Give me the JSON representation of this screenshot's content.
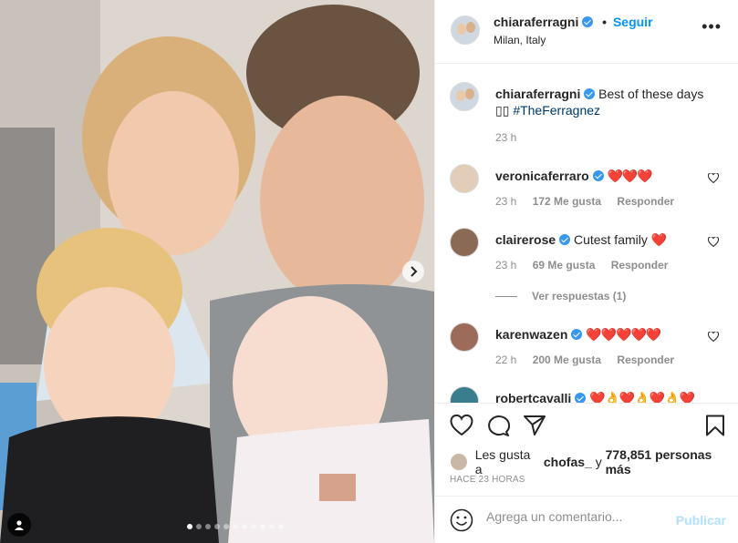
{
  "post": {
    "author": "chiaraferragni",
    "follow_separator": "•",
    "follow_label": "Seguir",
    "location": "Milan, Italy",
    "more_label": "•••",
    "carousel": {
      "slide_count": 11,
      "active_index": 0
    }
  },
  "caption": {
    "username": "chiaraferragni",
    "text": "Best of these days",
    "emoji_line": "▯▯",
    "hashtag": "#TheFerragnez",
    "time": "23 h"
  },
  "comments": [
    {
      "username": "veronicaferraro",
      "text": "",
      "hearts": "❤️❤️❤️",
      "time": "23 h",
      "likes": "172 Me gusta",
      "reply": "Responder"
    },
    {
      "username": "clairerose",
      "text": "Cutest family",
      "hearts": "❤️",
      "time": "23 h",
      "likes": "69 Me gusta",
      "reply": "Responder",
      "view_replies": "Ver respuestas (1)"
    },
    {
      "username": "karenwazen",
      "text": "",
      "hearts": "❤️❤️❤️❤️❤️",
      "time": "22 h",
      "likes": "200 Me gusta",
      "reply": "Responder"
    },
    {
      "username": "robertcavalli",
      "text": "",
      "hearts": "❤️👌❤️👌❤️👌❤️👌"
    }
  ],
  "likes_line": {
    "prefix": "Les gusta a",
    "first_user": "chofas_",
    "connector": "y",
    "count": "778,851 personas más"
  },
  "timestamp": "HACE 23 HORAS",
  "add_comment": {
    "placeholder": "Agrega un comentario...",
    "publish_label": "Publicar"
  },
  "colors": {
    "link": "#0095f6",
    "verified": "#3897f0",
    "muted": "#8e8e8e",
    "publish_disabled": "#b2dffc"
  },
  "icons": [
    "heart-icon",
    "comment-icon",
    "share-icon",
    "save-icon",
    "emoji-icon",
    "verified-icon",
    "chevron-right-icon",
    "user-tag-icon"
  ]
}
